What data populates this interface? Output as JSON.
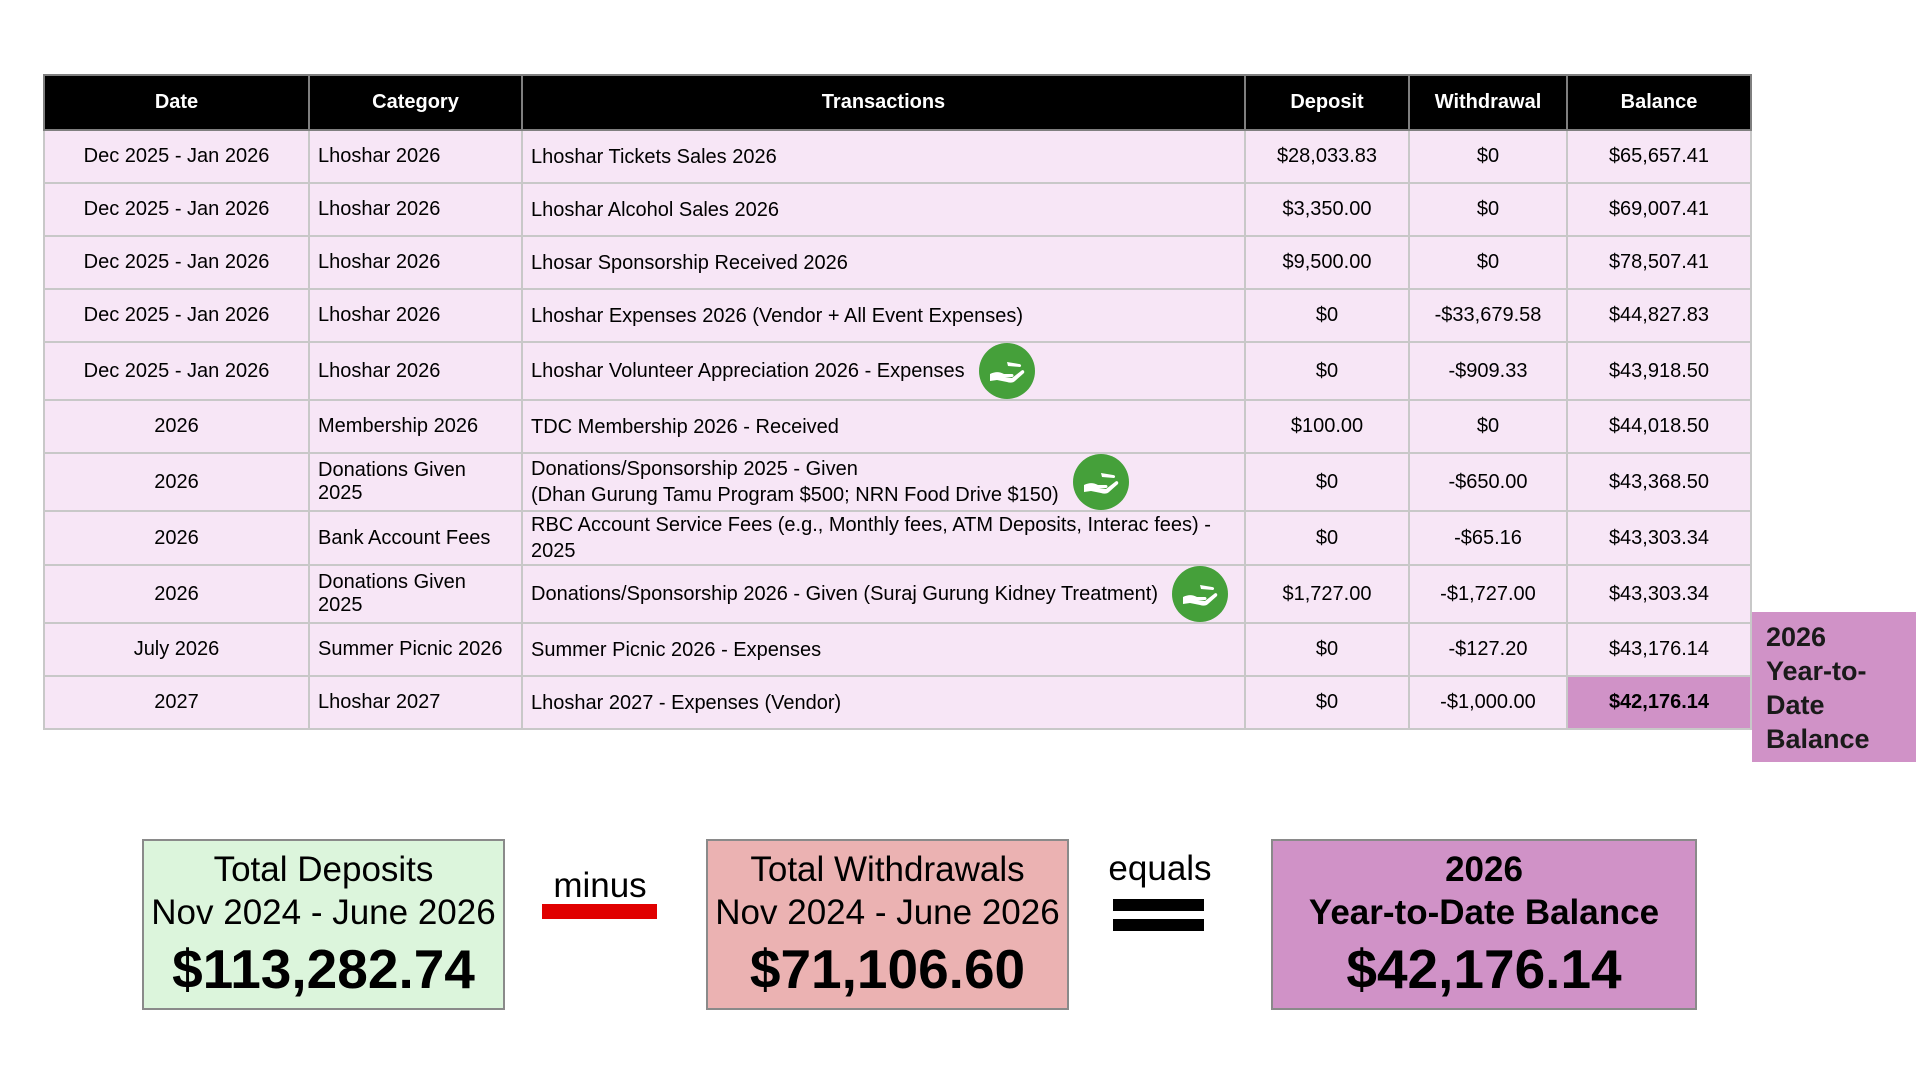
{
  "table": {
    "headers": [
      "Date",
      "Category",
      "Transactions",
      "Deposit",
      "Withdrawal",
      "Balance"
    ],
    "rows": [
      {
        "date": "Dec 2025 - Jan 2026",
        "category": "Lhoshar 2026",
        "transaction": "Lhoshar Tickets Sales 2026",
        "transaction_line2": "",
        "icon": "",
        "deposit": "$28,033.83",
        "withdrawal": "$0",
        "balance": "$65,657.41"
      },
      {
        "date": "Dec 2025 - Jan 2026",
        "category": "Lhoshar 2026",
        "transaction": "Lhoshar Alcohol Sales 2026",
        "transaction_line2": "",
        "icon": "",
        "deposit": "$3,350.00",
        "withdrawal": "$0",
        "balance": "$69,007.41"
      },
      {
        "date": "Dec 2025 - Jan 2026",
        "category": "Lhoshar 2026",
        "transaction": "Lhosar Sponsorship Received 2026",
        "transaction_line2": "",
        "icon": "",
        "deposit": "$9,500.00",
        "withdrawal": "$0",
        "balance": "$78,507.41"
      },
      {
        "date": "Dec 2025 - Jan 2026",
        "category": "Lhoshar 2026",
        "transaction": "Lhoshar Expenses 2026 (Vendor + All Event Expenses)",
        "transaction_line2": "",
        "icon": "",
        "deposit": "$0",
        "withdrawal": "-$33,679.58",
        "balance": "$44,827.83"
      },
      {
        "date": "Dec 2025 - Jan 2026",
        "category": "Lhoshar 2026",
        "transaction": "Lhoshar Volunteer Appreciation 2026 - Expenses",
        "transaction_line2": "",
        "icon": "giving-hand-icon",
        "deposit": "$0",
        "withdrawal": "-$909.33",
        "balance": "$43,918.50"
      },
      {
        "date": "2026",
        "category": "Membership 2026",
        "transaction": "TDC Membership 2026 - Received",
        "transaction_line2": "",
        "icon": "",
        "deposit": "$100.00",
        "withdrawal": "$0",
        "balance": "$44,018.50"
      },
      {
        "date": "2026",
        "category": "Donations Given 2025",
        "transaction": "Donations/Sponsorship 2025 - Given",
        "transaction_line2": "(Dhan Gurung Tamu Program $500; NRN Food Drive $150)",
        "icon": "giving-hand-icon",
        "deposit": "$0",
        "withdrawal": "-$650.00",
        "balance": "$43,368.50"
      },
      {
        "date": "2026",
        "category": "Bank Account Fees",
        "transaction": "RBC Account Service Fees (e.g., Monthly fees, ATM Deposits, Interac fees) - 2025",
        "transaction_line2": "",
        "icon": "",
        "deposit": "$0",
        "withdrawal": "-$65.16",
        "balance": "$43,303.34"
      },
      {
        "date": "2026",
        "category": "Donations Given 2025",
        "transaction": "Donations/Sponsorship 2026 - Given (Suraj Gurung Kidney Treatment)",
        "transaction_line2": "",
        "icon": "giving-hand-icon",
        "deposit": "$1,727.00",
        "withdrawal": "-$1,727.00",
        "balance": "$43,303.34"
      },
      {
        "date": "July 2026",
        "category": "Summer Picnic 2026",
        "transaction": "Summer Picnic 2026 - Expenses",
        "transaction_line2": "",
        "icon": "",
        "deposit": "$0",
        "withdrawal": "-$127.20",
        "balance": "$43,176.14"
      },
      {
        "date": "2027",
        "category": "Lhoshar 2027",
        "transaction": "Lhoshar 2027 - Expenses (Vendor)",
        "transaction_line2": "",
        "icon": "",
        "deposit": "$0",
        "withdrawal": "-$1,000.00",
        "balance": "$42,176.14"
      }
    ]
  },
  "side_label": [
    "2026",
    "Year-to-",
    "Date",
    "Balance"
  ],
  "summary": {
    "deposits": {
      "line1": "Total Deposits",
      "line2": "Nov 2024 - June 2026",
      "amount": "$113,282.74"
    },
    "minus_label": "minus",
    "withdrawals": {
      "line1": "Total Withdrawals",
      "line2": "Nov 2024 - June 2026",
      "amount": "$71,106.60"
    },
    "equals_label": "equals",
    "balance": {
      "line1": "2026",
      "line2": "Year-to-Date Balance",
      "amount": "$42,176.14"
    }
  },
  "colors": {
    "header_bg": "#000000",
    "row_bg": "#f7e6f6",
    "highlight_purple": "#d092c7",
    "deposit_box": "#dcf5dc",
    "withdrawal_box": "#ebb2b2",
    "icon_green": "#45a03a",
    "minus_red": "#e00000"
  }
}
